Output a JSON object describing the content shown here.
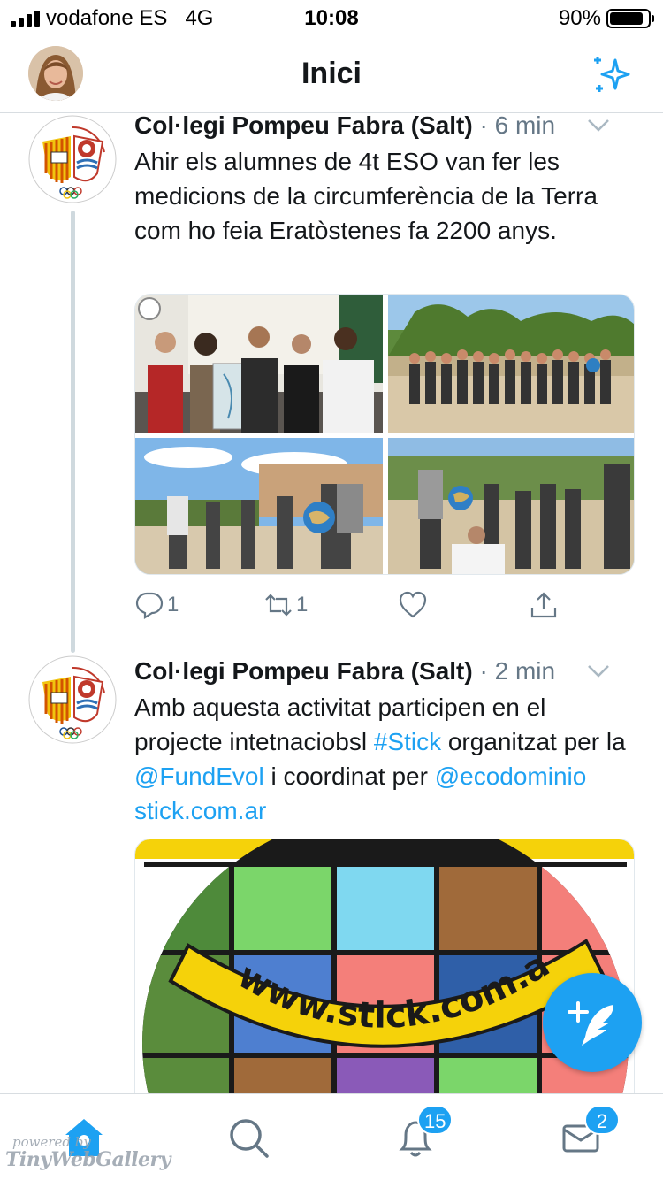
{
  "status_bar": {
    "carrier": "vodafone ES",
    "network": "4G",
    "time": "10:08",
    "battery_pct": "90%"
  },
  "header": {
    "title": "Inici",
    "left_icon": "profile-avatar",
    "right_icon": "sparkle-icon"
  },
  "tweets": [
    {
      "author": "Col·legi Pompeu Fabra (Salt)",
      "time": "· 6 min",
      "text": "Ahir els alumnes de 4t ESO van fer les medicions de la circumferència de la Terra com ho feia Eratòstenes fa 2200 anys.",
      "media_count": 4,
      "reply_count": "1",
      "retweet_count": "1",
      "like_count": "",
      "icons": [
        "reply-icon",
        "retweet-icon",
        "like-icon",
        "share-icon"
      ]
    },
    {
      "author": "Col·legi Pompeu Fabra (Salt)",
      "time": "· 2 min",
      "text_parts": {
        "t1": "Amb aquesta activitat participen en el projecte intetnaciobsl ",
        "hashtag": "#Stick",
        "t2": " organitzat per la ",
        "mention1": "@FundEvol",
        "t3": " i coordinat per ",
        "mention2": "@ecodominio",
        "t4": " ",
        "url": "stick.com.ar"
      },
      "card_image_text": "www.stick.com.ar"
    }
  ],
  "tab_bar": {
    "items": [
      "home-icon",
      "search-icon",
      "notifications-icon",
      "messages-icon"
    ],
    "notifications_badge": "15",
    "messages_badge": "2"
  },
  "watermark": {
    "line1": "powered by",
    "line2": "TinyWebGallery"
  },
  "colors": {
    "accent": "#1da1f2",
    "text": "#14171a",
    "secondary": "#657786",
    "divider": "#d8dde1"
  }
}
